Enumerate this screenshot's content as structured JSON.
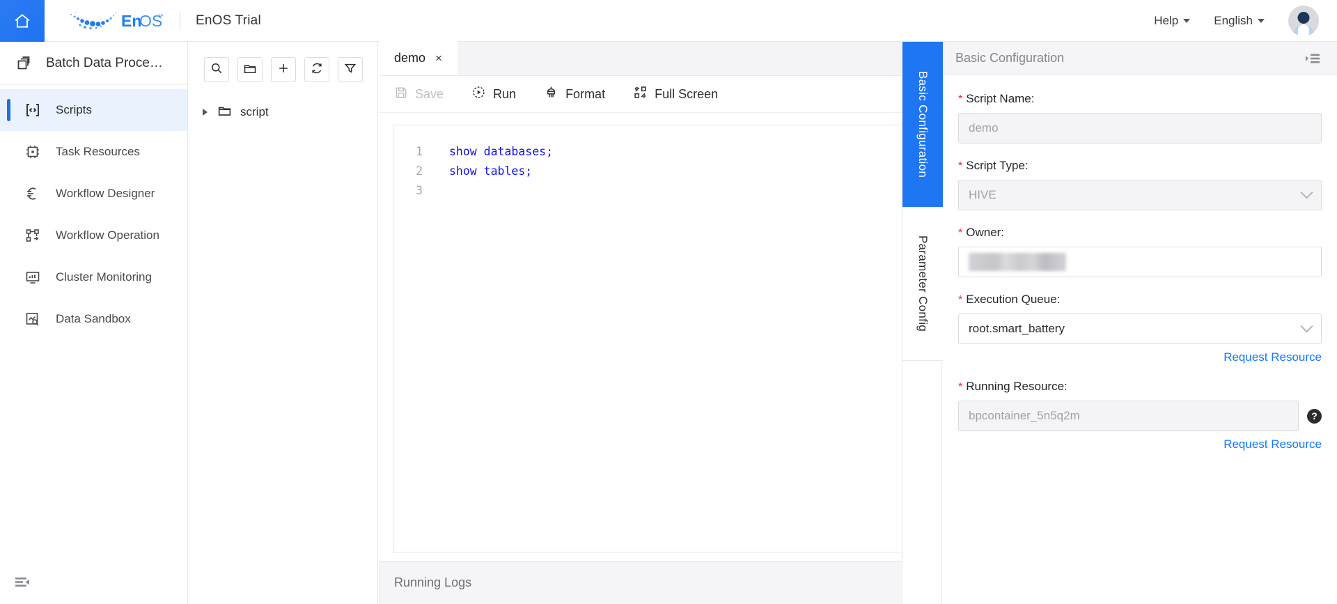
{
  "topbar": {
    "home_icon": "home-icon",
    "brand_text": "EnOS",
    "brand_tm": "™",
    "product_title": "EnOS Trial",
    "help_label": "Help",
    "language_label": "English",
    "avatar_icon": "user-avatar"
  },
  "sidebar": {
    "header": "Batch Data Proce…",
    "header_icon": "stacked-layers-icon",
    "collapse_icon": "collapse-sidebar-icon",
    "items": [
      {
        "label": "Scripts",
        "icon": "code-brackets-icon",
        "active": true
      },
      {
        "label": "Task Resources",
        "icon": "chip-icon",
        "active": false
      },
      {
        "label": "Workflow Designer",
        "icon": "workflow-designer-icon",
        "active": false
      },
      {
        "label": "Workflow Operation",
        "icon": "workflow-operation-icon",
        "active": false
      },
      {
        "label": "Cluster Monitoring",
        "icon": "monitor-chart-icon",
        "active": false
      },
      {
        "label": "Data Sandbox",
        "icon": "sandbox-search-icon",
        "active": false
      }
    ]
  },
  "file_panel": {
    "tools": [
      {
        "name": "search-icon",
        "title": "Search"
      },
      {
        "name": "new-folder-icon",
        "title": "New Folder"
      },
      {
        "name": "plus-icon",
        "title": "New"
      },
      {
        "name": "refresh-icon",
        "title": "Refresh"
      },
      {
        "name": "filter-icon",
        "title": "Filter"
      }
    ],
    "tree": [
      {
        "label": "script",
        "icon": "folder-icon",
        "expanded": false
      }
    ]
  },
  "editor": {
    "tabs": [
      {
        "label": "demo",
        "close": "×",
        "active": true
      }
    ],
    "toolbar": [
      {
        "label": "Save",
        "icon": "save-icon",
        "disabled": true
      },
      {
        "label": "Run",
        "icon": "run-icon",
        "disabled": false
      },
      {
        "label": "Format",
        "icon": "format-brush-icon",
        "disabled": false
      },
      {
        "label": "Full Screen",
        "icon": "fullscreen-icon",
        "disabled": false
      }
    ],
    "code_lines": [
      {
        "n": "1",
        "text": "show databases;"
      },
      {
        "n": "2",
        "text": "show tables;"
      },
      {
        "n": "3",
        "text": ""
      }
    ],
    "logs_title": "Running Logs"
  },
  "vtabs": [
    {
      "label": "Basic Configuration",
      "active": true
    },
    {
      "label": "Parameter Config",
      "active": false
    }
  ],
  "config": {
    "panel_title": "Basic Configuration",
    "panel_icon": "panel-collapse-icon",
    "fields": {
      "script_name": {
        "label": "Script Name:",
        "required": true,
        "value": "demo",
        "disabled": true
      },
      "script_type": {
        "label": "Script Type:",
        "required": true,
        "value": "HIVE",
        "disabled": true,
        "select": true
      },
      "owner": {
        "label": "Owner:",
        "required": true,
        "value": "",
        "redacted": true,
        "disabled": false
      },
      "execution_queue": {
        "label": "Execution Queue:",
        "required": true,
        "value": "root.smart_battery",
        "disabled": false,
        "select": true,
        "link": "Request Resource"
      },
      "running_resource": {
        "label": "Running Resource:",
        "required": true,
        "value": "bpcontainer_5n5q2m",
        "disabled": true,
        "help_icon": "question-mark-icon",
        "link": "Request Resource"
      }
    }
  },
  "colors": {
    "accent": "#1f76f2",
    "link": "#1677ff",
    "required": "#f5222d",
    "code": "#1010f0",
    "active_nav_bg": "#eaf2fe"
  }
}
